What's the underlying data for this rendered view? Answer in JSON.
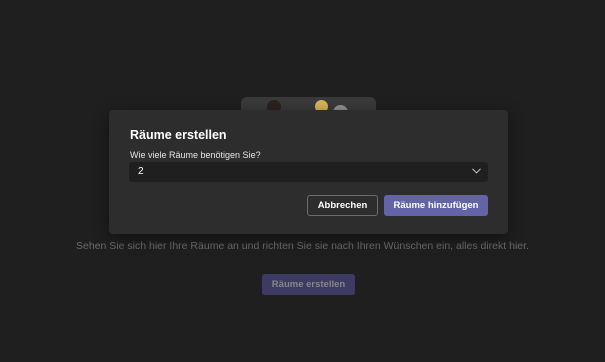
{
  "background": {
    "hint_text": "Sehen Sie sich hier Ihre Räume an und richten Sie sie nach Ihren Wünschen ein, alles direkt hier.",
    "create_button_label": "Räume erstellen"
  },
  "dialog": {
    "title": "Räume erstellen",
    "field_label": "Wie viele Räume benötigen Sie?",
    "selected_value": "2",
    "cancel_label": "Abbrechen",
    "confirm_label": "Räume hinzufügen"
  },
  "colors": {
    "page_background": "#1f1f1f",
    "dialog_background": "#2d2d2d",
    "accent": "#6264a7"
  },
  "icons": {
    "dropdown": "chevron-down-icon"
  }
}
